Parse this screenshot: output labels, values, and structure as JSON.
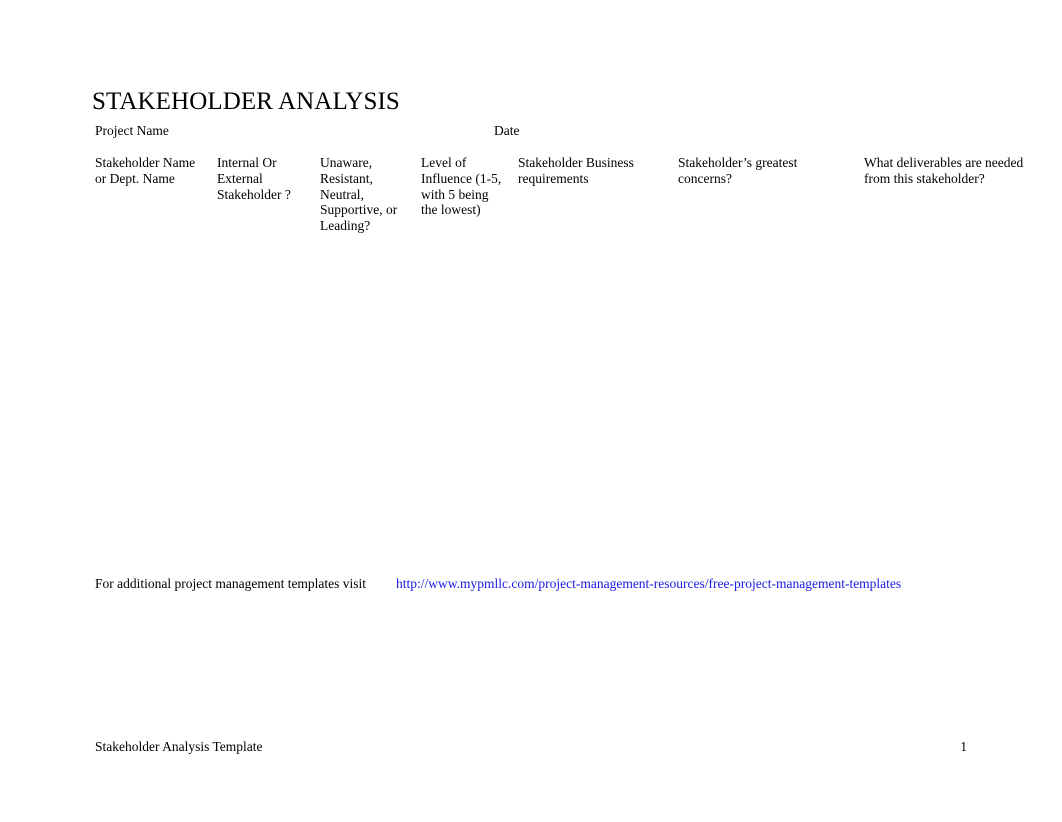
{
  "document": {
    "title": "STAKEHOLDER ANALYSIS",
    "link_color": "#1a1ae6",
    "text_color": "#000000",
    "background_color": "#ffffff"
  },
  "meta": {
    "project_name_label": "Project Name",
    "date_label": "Date"
  },
  "table": {
    "headers": [
      "Stakeholder Name or Dept. Name",
      "Internal Or External Stakeholder ?",
      "Unaware, Resistant, Neutral, Supportive, or Leading?",
      "Level of Influence (1-5, with 5 being the lowest)",
      "Stakeholder Business requirements",
      "Stakeholder’s greatest concerns?",
      "What deliverables are needed from this stakeholder?"
    ],
    "rows": [
      [
        "",
        "",
        "",
        "",
        "",
        "",
        ""
      ],
      [
        "",
        "",
        "",
        "",
        "",
        "",
        ""
      ],
      [
        "",
        "",
        "",
        "",
        "",
        "",
        ""
      ],
      [
        "",
        "",
        "",
        "",
        "",
        "",
        ""
      ],
      [
        "",
        "",
        "",
        "",
        "",
        "",
        ""
      ],
      [
        "",
        "",
        "",
        "",
        "",
        "",
        ""
      ]
    ]
  },
  "footer_note": {
    "text": "For additional project management templates visit",
    "link_text": "http://www.mypmllc.com/project-management-resources/free-project-management-templates"
  },
  "page_footer": {
    "document_name": "Stakeholder Analysis Template",
    "page_number": "1"
  }
}
